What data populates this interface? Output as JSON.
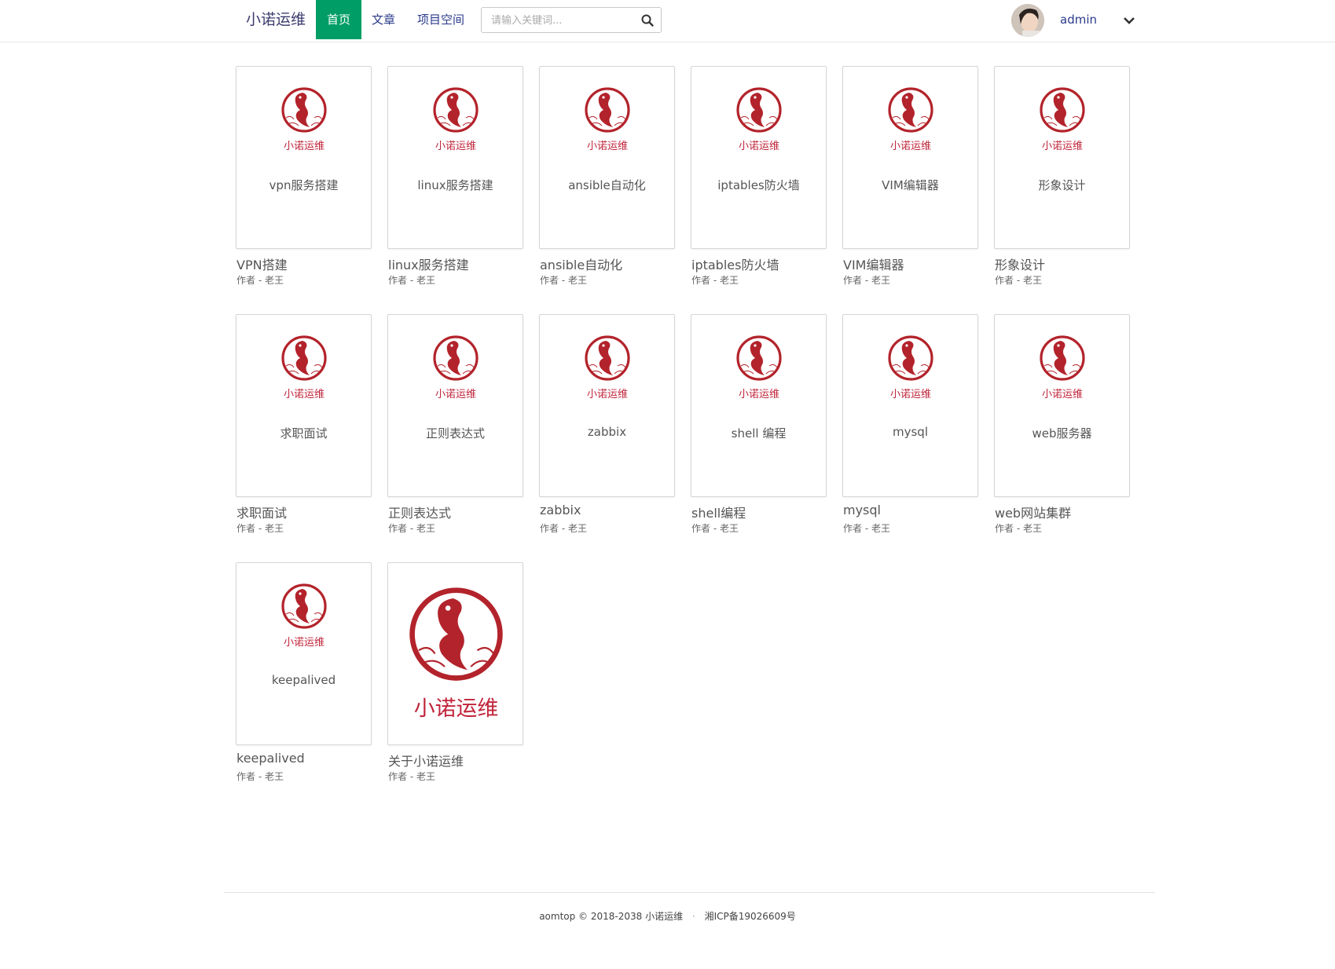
{
  "navbar": {
    "brand": "小诺运维",
    "items": [
      {
        "label": "首页",
        "active": true
      },
      {
        "label": "文章",
        "active": false
      },
      {
        "label": "项目空间",
        "active": false
      }
    ],
    "search_placeholder": "请输入关键词...",
    "search_icon": "search-icon",
    "username": "admin",
    "dropdown_icon": "chevron-down-icon",
    "accent_color": "#009e66"
  },
  "books": [
    {
      "cover_text": "vpn服务搭建",
      "title": "VPN搭建",
      "author": "作者 - 老王"
    },
    {
      "cover_text": "linux服务搭建",
      "title": "linux服务搭建",
      "author": "作者 - 老王"
    },
    {
      "cover_text": "ansible自动化",
      "title": "ansible自动化",
      "author": "作者 - 老王"
    },
    {
      "cover_text": "iptables防火墙",
      "title": "iptables防火墙",
      "author": "作者 - 老王"
    },
    {
      "cover_text": "VIM编辑器",
      "title": "VIM编辑器",
      "author": "作者 - 老王"
    },
    {
      "cover_text": "形象设计",
      "title": "形象设计",
      "author": "作者 - 老王"
    },
    {
      "cover_text": "求职面试",
      "title": "求职面试",
      "author": "作者 - 老王"
    },
    {
      "cover_text": "正则表达式",
      "title": "正则表达式",
      "author": "作者 - 老王"
    },
    {
      "cover_text": "zabbix",
      "title": "zabbix",
      "author": "作者 - 老王"
    },
    {
      "cover_text": "shell 编程",
      "title": "shell编程",
      "author": "作者 - 老王"
    },
    {
      "cover_text": "mysql",
      "title": "mysql",
      "author": "作者 - 老王"
    },
    {
      "cover_text": "web服务器",
      "title": "web网站集群",
      "author": "作者 - 老王"
    },
    {
      "cover_text": "keepalived",
      "title": "keepalived",
      "author": "作者 - 老王"
    },
    {
      "cover_text": "",
      "title": "关于小诺运维",
      "author": "作者 - 老王"
    }
  ],
  "logo": {
    "text": "小诺运维",
    "color": "#b3232b",
    "icon": "koi-fish-logo-icon"
  },
  "footer": {
    "copyright": "aomtop © 2018-2038 小诺运维",
    "separator": "·",
    "icp": "湘ICP备19026609号"
  }
}
